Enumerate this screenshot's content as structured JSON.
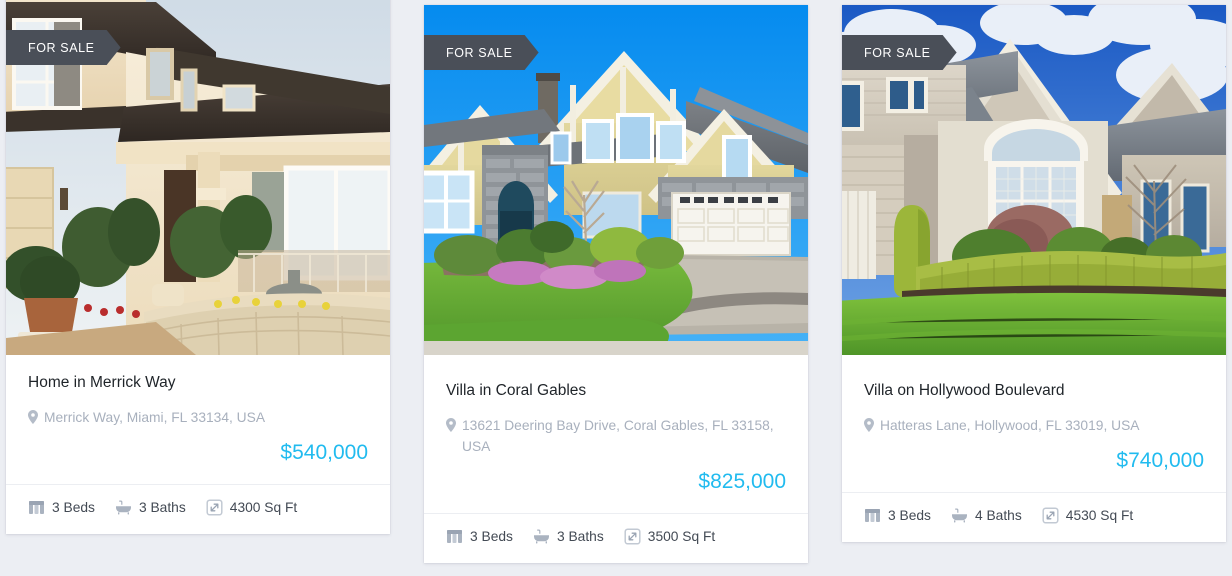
{
  "theme": {
    "page_background": "#eceef3",
    "card_background": "#ffffff",
    "badge_background": "#4a4f58",
    "badge_text_color": "#ffffff",
    "price_color": "#21bbef",
    "title_color": "#1f2429",
    "address_color": "#a8b0bd",
    "feature_text_color": "#434a54"
  },
  "listings": [
    {
      "badge": "FOR SALE",
      "title": "Home in Merrick Way",
      "address": "Merrick Way, Miami, FL 33134, USA",
      "price": "$540,000",
      "features": {
        "beds": "3 Beds",
        "baths": "3 Baths",
        "area": "4300 Sq Ft"
      },
      "icons": {
        "address": "map-pin-icon",
        "beds": "bed-icon",
        "baths": "bathtub-icon",
        "area": "area-expand-icon"
      },
      "photo": "stucco-house-with-stone-planter"
    },
    {
      "badge": "FOR SALE",
      "title": "Villa in Coral Gables",
      "address": "13621 Deering Bay Drive, Coral Gables, FL 33158, USA",
      "price": "$825,000",
      "features": {
        "beds": "3 Beds",
        "baths": "3 Baths",
        "area": "3500 Sq Ft"
      },
      "icons": {
        "address": "map-pin-icon",
        "beds": "bed-icon",
        "baths": "bathtub-icon",
        "area": "area-expand-icon"
      },
      "photo": "craftsman-house-blue-sky-garage"
    },
    {
      "badge": "FOR SALE",
      "title": "Villa on Hollywood Boulevard",
      "address": "Hatteras Lane, Hollywood, FL 33019, USA",
      "price": "$740,000",
      "features": {
        "beds": "3 Beds",
        "baths": "4 Baths",
        "area": "4530 Sq Ft"
      },
      "icons": {
        "address": "map-pin-icon",
        "beds": "bed-icon",
        "baths": "bathtub-icon",
        "area": "area-expand-icon"
      },
      "photo": "gabled-house-with-hedges"
    }
  ]
}
